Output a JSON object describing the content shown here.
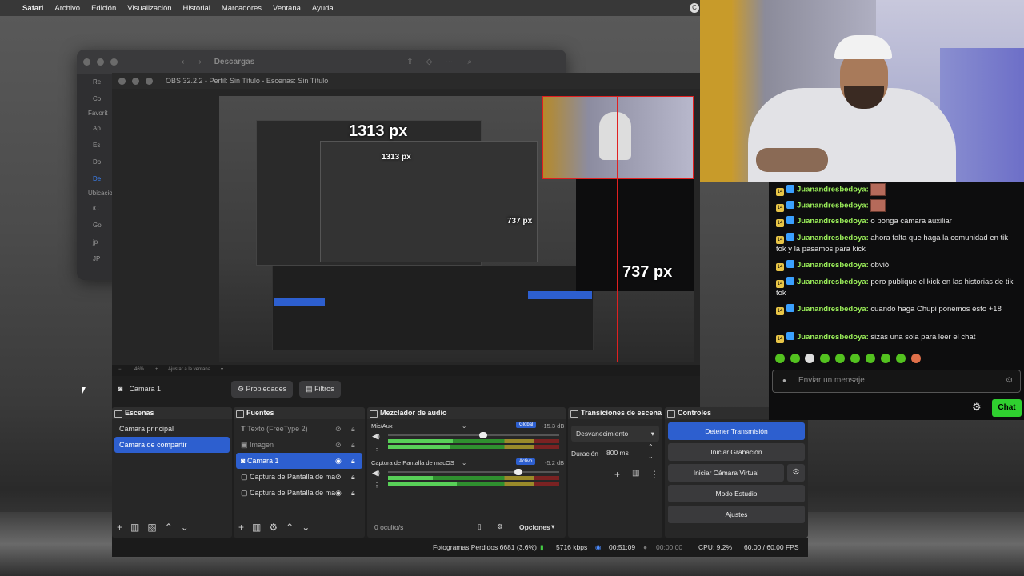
{
  "menubar": {
    "app": "Safari",
    "items": [
      "Archivo",
      "Edición",
      "Visualización",
      "Historial",
      "Marcadores",
      "Ventana",
      "Ayuda"
    ]
  },
  "safari": {
    "title": "Descargas",
    "sidebar_items": [
      "Re",
      "Co",
      "Favorit",
      "Ap",
      "Es",
      "Do",
      "De",
      "Ubicacio",
      "iC",
      "Go",
      "jp",
      "JP"
    ]
  },
  "obs": {
    "window_title": "OBS 32.2.2 - Perfil: Sin Título - Escenas: Sin Título",
    "preview": {
      "measure_width": "1313 px",
      "measure_height": "737 px",
      "inner_width": "1313 px",
      "inner_height": "737 px"
    },
    "zoom_label": "46%",
    "zoom_fit": "Ajustar a la ventana",
    "source_bar": {
      "selected_source": "Camara 1",
      "properties_label": "Propiedades",
      "filters_label": "Filtros"
    },
    "scenes": {
      "title": "Escenas",
      "items": [
        "Camara principal",
        "Camara de compartir"
      ]
    },
    "sources": {
      "title": "Fuentes",
      "items": [
        "Texto (FreeType 2)",
        "Imagen",
        "Camara 1",
        "Captura de Pantalla de mac",
        "Captura de Pantalla de mac"
      ]
    },
    "mixer": {
      "title": "Mezclador de audio",
      "channels": [
        {
          "name": "Mic/Aux",
          "tag": "Global",
          "db": "-15.3 dB"
        },
        {
          "name": "Captura de Pantalla de macOS",
          "tag": "Activo",
          "db": "-5.2 dB"
        }
      ],
      "hidden": "0 oculto/s",
      "options": "Opciones"
    },
    "transitions": {
      "title": "Transiciones de escena",
      "selected": "Desvanecimiento",
      "duration_label": "Duración",
      "duration_value": "800 ms"
    },
    "controls": {
      "title": "Controles",
      "buttons": [
        "Detener Transmisión",
        "Iniciar Grabación",
        "Iniciar Cámara Virtual",
        "Modo Estudio",
        "Ajustes"
      ]
    },
    "status": {
      "dropped": "Fotogramas Perdidos 6681 (3.6%)",
      "bitrate": "5716 kbps",
      "stream_time": "00:51:09",
      "rec_time": "00:00:00",
      "cpu": "CPU: 9.2%",
      "fps": "60.00 / 60.00 FPS"
    }
  },
  "chat": {
    "messages": [
      {
        "badge": "14",
        "user": "Juanandresbedoya:",
        "text": "",
        "emote": true
      },
      {
        "badge": "14",
        "user": "Juanandresbedoya:",
        "text": "",
        "emote": true
      },
      {
        "badge": "14",
        "user": "Juanandresbedoya:",
        "text": "o ponga cámara auxiliar"
      },
      {
        "badge": "14",
        "user": "Juanandresbedoya:",
        "text": "ahora falta que haga la comunidad en tik tok y la pasamos para kick"
      },
      {
        "badge": "14",
        "user": "Juanandresbedoya:",
        "text": "obvió"
      },
      {
        "badge": "14",
        "user": "Juanandresbedoya:",
        "text": "pero publique el kick en las historias de tik tok"
      },
      {
        "badge": "14",
        "user": "Juanandresbedoya:",
        "text": "cuando haga Chupi ponemos ésto +18"
      },
      {
        "badge": "14",
        "user": "Juanandresbedoya:",
        "text": "sizas una sola para leer el chat"
      }
    ],
    "input_placeholder": "Enviar un mensaje",
    "send_label": "Chat"
  }
}
